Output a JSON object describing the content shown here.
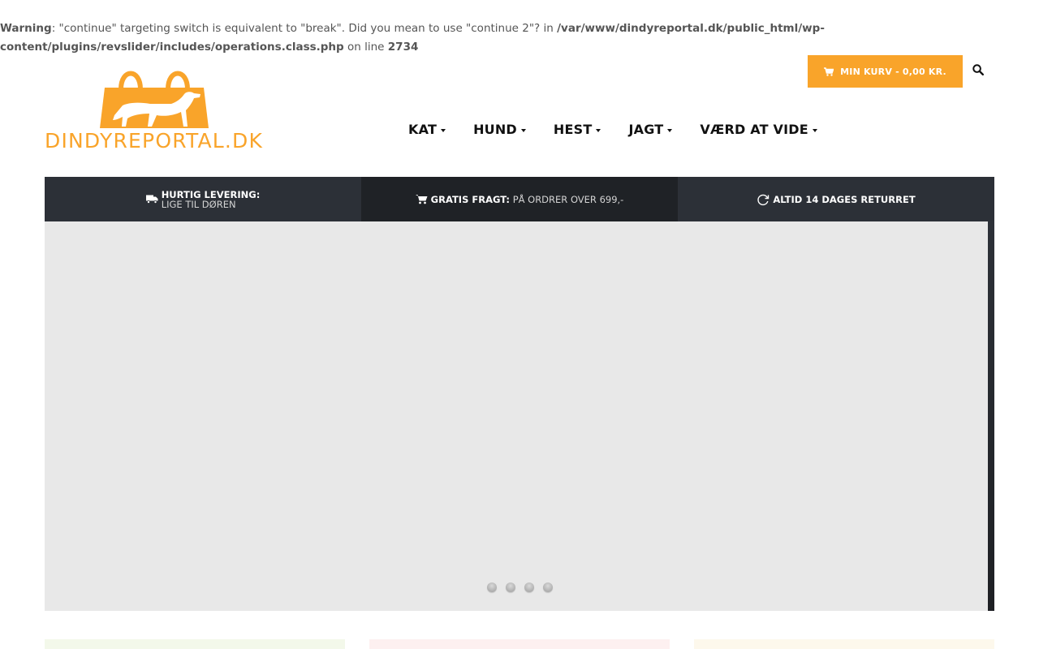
{
  "warning": {
    "label": "Warning",
    "message": ": \"continue\" targeting switch is equivalent to \"break\". Did you mean to use \"continue 2\"? in ",
    "path": "/var/www/dindyreportal.dk/public_html/wp-content/plugins/revslider/includes/operations.class.php",
    "on_line": " on line ",
    "line": "2734"
  },
  "header": {
    "cart_label": "MIN KURV - 0,00 KR.",
    "logo_text": "DINDYREPORTAL.DK"
  },
  "nav": {
    "items": [
      {
        "label": "KAT"
      },
      {
        "label": "HUND"
      },
      {
        "label": "HEST"
      },
      {
        "label": "JAGT"
      },
      {
        "label": "VÆRD AT VIDE"
      }
    ]
  },
  "usp": {
    "delivery_strong": "HURTIG LEVERING:",
    "delivery_light": "LIGE TIL DØREN",
    "shipping_strong": "GRATIS FRAGT:",
    "shipping_light": "PÅ ORDRER OVER 699,-",
    "returns_strong": "ALTID 14 DAGES RETURRET"
  },
  "icons": {
    "cart": "cart-icon",
    "search": "search-icon",
    "truck": "truck-icon",
    "shipping_cart": "cart-icon",
    "returns": "refresh-icon"
  },
  "colors": {
    "accent": "#f9a42a",
    "bar_dark": "#2c3037",
    "bar_darker": "#1f2226",
    "slider_bg": "#e8e8e8"
  },
  "slider": {
    "dot_count": 4
  }
}
